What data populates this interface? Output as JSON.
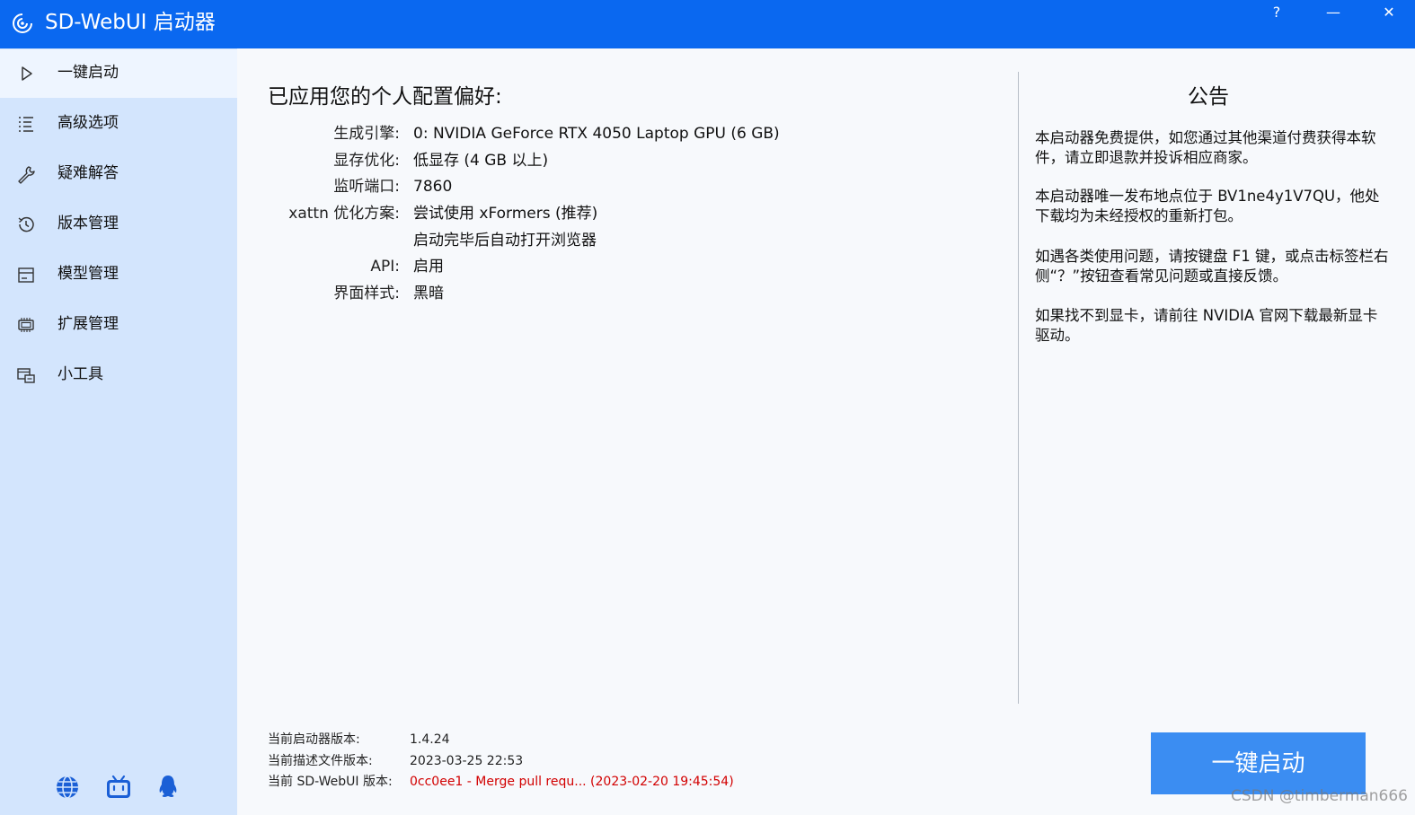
{
  "window": {
    "title": "SD-WebUI 启动器",
    "help_label": "?",
    "minimize_label": "—",
    "close_label": "✕"
  },
  "sidebar": {
    "items": [
      {
        "label": "一键启动",
        "icon": "play-icon",
        "active": true
      },
      {
        "label": "高级选项",
        "icon": "list-icon"
      },
      {
        "label": "疑难解答",
        "icon": "wrench-icon"
      },
      {
        "label": "版本管理",
        "icon": "history-icon"
      },
      {
        "label": "模型管理",
        "icon": "archive-icon"
      },
      {
        "label": "扩展管理",
        "icon": "chip-icon"
      },
      {
        "label": "小工具",
        "icon": "toolbox-icon"
      }
    ],
    "bottom_icons": [
      "globe-icon",
      "bilibili-icon",
      "qq-icon"
    ]
  },
  "preferences": {
    "title": "已应用您的个人配置偏好:",
    "rows": [
      {
        "key": "生成引擎:",
        "value": "0: NVIDIA GeForce RTX 4050 Laptop GPU (6 GB)"
      },
      {
        "key": "显存优化:",
        "value": "低显存 (4 GB 以上)"
      },
      {
        "key": "监听端口:",
        "value": "7860"
      },
      {
        "key": "xattn 优化方案:",
        "value": "尝试使用 xFormers (推荐)"
      },
      {
        "key": "",
        "value": "启动完毕后自动打开浏览器"
      },
      {
        "key": "API:",
        "value": "启用"
      },
      {
        "key": "界面样式:",
        "value": "黑暗"
      }
    ]
  },
  "notice": {
    "title": "公告",
    "paragraphs": [
      "本启动器免费提供，如您通过其他渠道付费获得本软件，请立即退款并投诉相应商家。",
      "本启动器唯一发布地点位于 BV1ne4y1V7QU，他处下载均为未经授权的重新打包。",
      "如遇各类使用问题，请按键盘 F1 键，或点击标签栏右侧“？”按钮查看常见问题或直接反馈。",
      "如果找不到显卡，请前往 NVIDIA 官网下载最新显卡驱动。"
    ]
  },
  "footer": {
    "rows": [
      {
        "key": "当前启动器版本:",
        "value": "1.4.24"
      },
      {
        "key": "当前描述文件版本:",
        "value": "2023-03-25 22:53"
      },
      {
        "key": "当前 SD-WebUI 版本:",
        "value": "0cc0ee1 - Merge pull requ... (2023-02-20 19:45:54)"
      }
    ],
    "warning_color": "#d20000"
  },
  "launch_button_label": "一键启动",
  "watermark": "CSDN @timberman666",
  "colors": {
    "titlebar": "#0a68f0",
    "sidebar": "#d3e5fd",
    "button": "#3b8df2"
  }
}
